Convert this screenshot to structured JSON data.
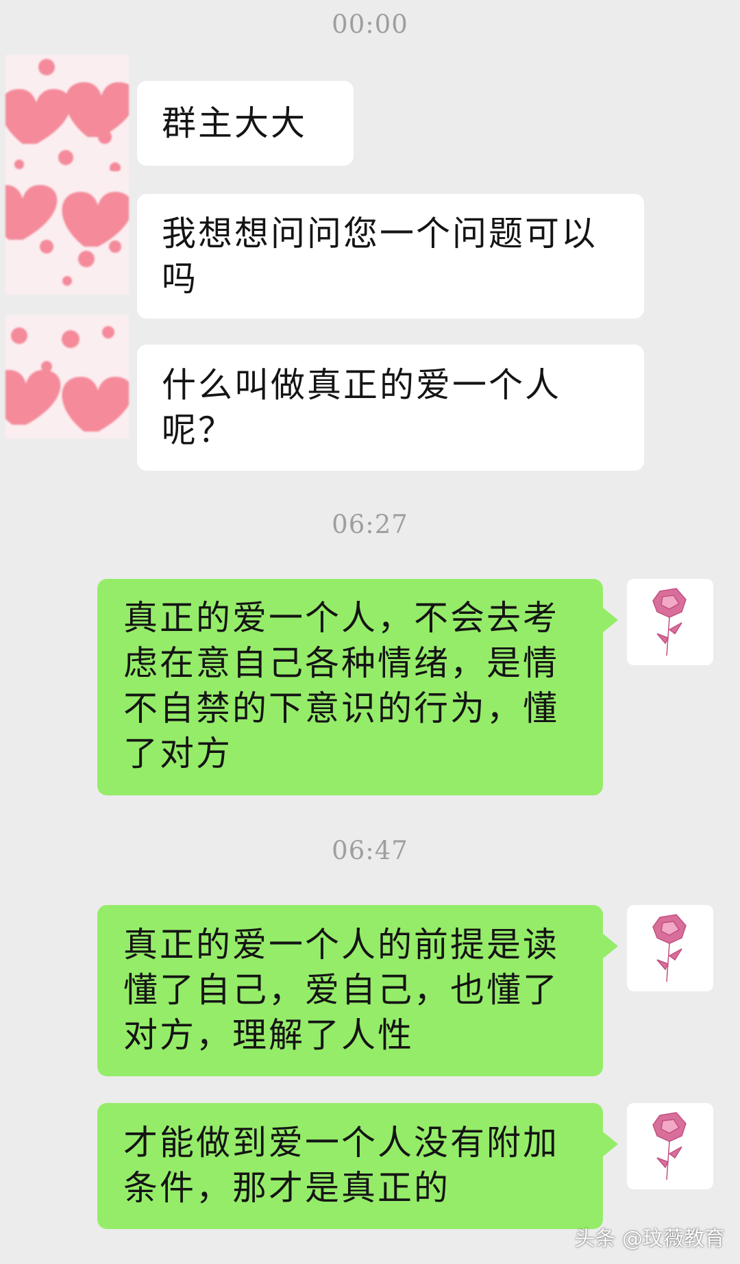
{
  "timestamps": [
    "00:00",
    "06:27",
    "06:47"
  ],
  "incoming": [
    "群主大大",
    "我想想问问您一个问题可以吗",
    "什么叫做真正的爱一个人呢？"
  ],
  "outgoing": [
    "真正的爱一个人，不会去考虑在意自己各种情绪，是情不自禁的下意识的行为，懂了对方",
    "真正的爱一个人的前提是读懂了自己，爱自己，也懂了对方，理解了人性",
    "才能做到爱一个人没有附加条件，那才是真正的"
  ],
  "icons": {
    "incoming_avatar": "pink-hearts-avatar-icon",
    "outgoing_avatar": "pink-rose-avatar-icon"
  },
  "colors": {
    "background": "#ececec",
    "incoming_bubble": "#ffffff",
    "outgoing_bubble": "#95ec69",
    "heart": "#f48a9a",
    "rose": "#d86f9a"
  },
  "watermark": "头条 @玟薇教育"
}
